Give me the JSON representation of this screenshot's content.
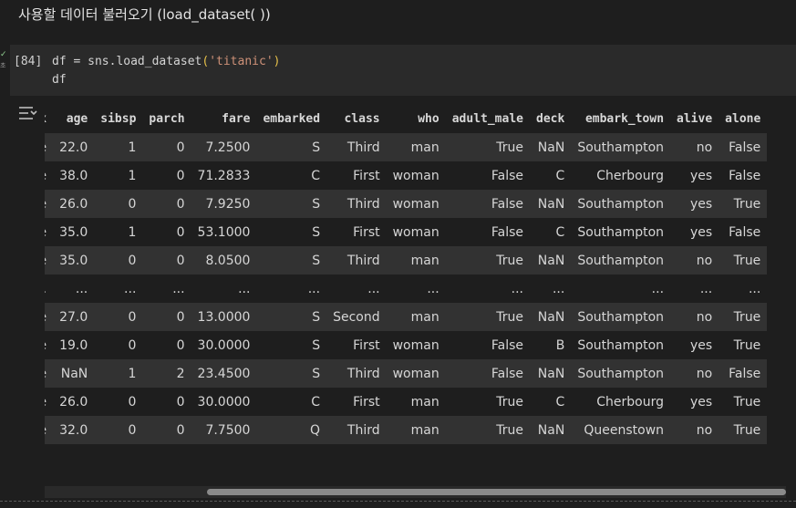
{
  "markdown": {
    "heading": "사용할 데이터 불러오기 (load_dataset( ))"
  },
  "cell": {
    "status_icon": "check-icon",
    "exec_time": "초",
    "exec_count": "[84]",
    "code": {
      "line1_prefix": "df = sns.load_dataset",
      "line1_open": "(",
      "line1_string": "'titanic'",
      "line1_close": ")",
      "line2": "df"
    }
  },
  "output": {
    "icon": "output-toggle-icon",
    "table": {
      "columns": [
        "ex",
        "age",
        "sibsp",
        "parch",
        "fare",
        "embarked",
        "class",
        "who",
        "adult_male",
        "deck",
        "embark_town",
        "alive",
        "alone"
      ],
      "rows": [
        [
          "ale",
          "22.0",
          "1",
          "0",
          "7.2500",
          "S",
          "Third",
          "man",
          "True",
          "NaN",
          "Southampton",
          "no",
          "False"
        ],
        [
          "ale",
          "38.0",
          "1",
          "0",
          "71.2833",
          "C",
          "First",
          "woman",
          "False",
          "C",
          "Cherbourg",
          "yes",
          "False"
        ],
        [
          "ale",
          "26.0",
          "0",
          "0",
          "7.9250",
          "S",
          "Third",
          "woman",
          "False",
          "NaN",
          "Southampton",
          "yes",
          "True"
        ],
        [
          "ale",
          "35.0",
          "1",
          "0",
          "53.1000",
          "S",
          "First",
          "woman",
          "False",
          "C",
          "Southampton",
          "yes",
          "False"
        ],
        [
          "ale",
          "35.0",
          "0",
          "0",
          "8.0500",
          "S",
          "Third",
          "man",
          "True",
          "NaN",
          "Southampton",
          "no",
          "True"
        ],
        [
          "...",
          "...",
          "...",
          "...",
          "...",
          "...",
          "...",
          "...",
          "...",
          "...",
          "...",
          "...",
          "..."
        ],
        [
          "ale",
          "27.0",
          "0",
          "0",
          "13.0000",
          "S",
          "Second",
          "man",
          "True",
          "NaN",
          "Southampton",
          "no",
          "True"
        ],
        [
          "ale",
          "19.0",
          "0",
          "0",
          "30.0000",
          "S",
          "First",
          "woman",
          "False",
          "B",
          "Southampton",
          "yes",
          "True"
        ],
        [
          "ale",
          "NaN",
          "1",
          "2",
          "23.4500",
          "S",
          "Third",
          "woman",
          "False",
          "NaN",
          "Southampton",
          "no",
          "False"
        ],
        [
          "ale",
          "26.0",
          "0",
          "0",
          "30.0000",
          "C",
          "First",
          "man",
          "True",
          "C",
          "Cherbourg",
          "yes",
          "True"
        ],
        [
          "ale",
          "32.0",
          "0",
          "0",
          "7.7500",
          "Q",
          "Third",
          "man",
          "True",
          "NaN",
          "Queenstown",
          "no",
          "True"
        ]
      ]
    }
  },
  "colors": {
    "background": "#1e1e1e",
    "cell_background": "#2a2a2a",
    "row_stripe": "#323232",
    "string_literal": "#ce9178",
    "bracket": "#e6c04a"
  }
}
